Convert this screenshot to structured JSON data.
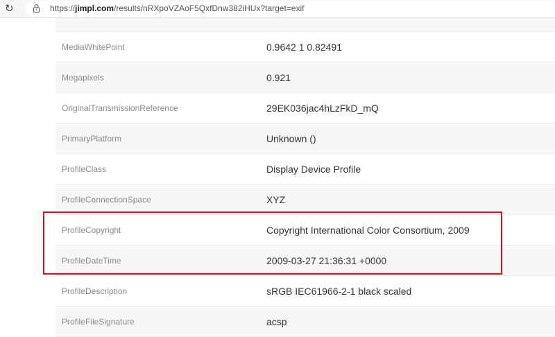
{
  "browser": {
    "url_prefix": "https://",
    "url_domain": "jimpl.com",
    "url_path": "/results/nRXpoVZAoF5QxfDnw382iHUx?target=exif"
  },
  "rows": [
    {
      "key": "MediaWhitePoint",
      "value": "0.9642 1 0.82491"
    },
    {
      "key": "Megapixels",
      "value": "0.921"
    },
    {
      "key": "OriginalTransmissionReference",
      "value": "29EK036jac4hLzFkD_mQ"
    },
    {
      "key": "PrimaryPlatform",
      "value": "Unknown ()"
    },
    {
      "key": "ProfileClass",
      "value": "Display Device Profile"
    },
    {
      "key": "ProfileConnectionSpace",
      "value": "XYZ"
    },
    {
      "key": "ProfileCopyright",
      "value": "Copyright International Color Consortium, 2009"
    },
    {
      "key": "ProfileDateTime",
      "value": "2009-03-27 21:36:31 +0000"
    },
    {
      "key": "ProfileDescription",
      "value": "sRGB IEC61966-2-1 black scaled"
    },
    {
      "key": "ProfileFileSignature",
      "value": "acsp"
    }
  ],
  "highlight_color": "#d9111b"
}
